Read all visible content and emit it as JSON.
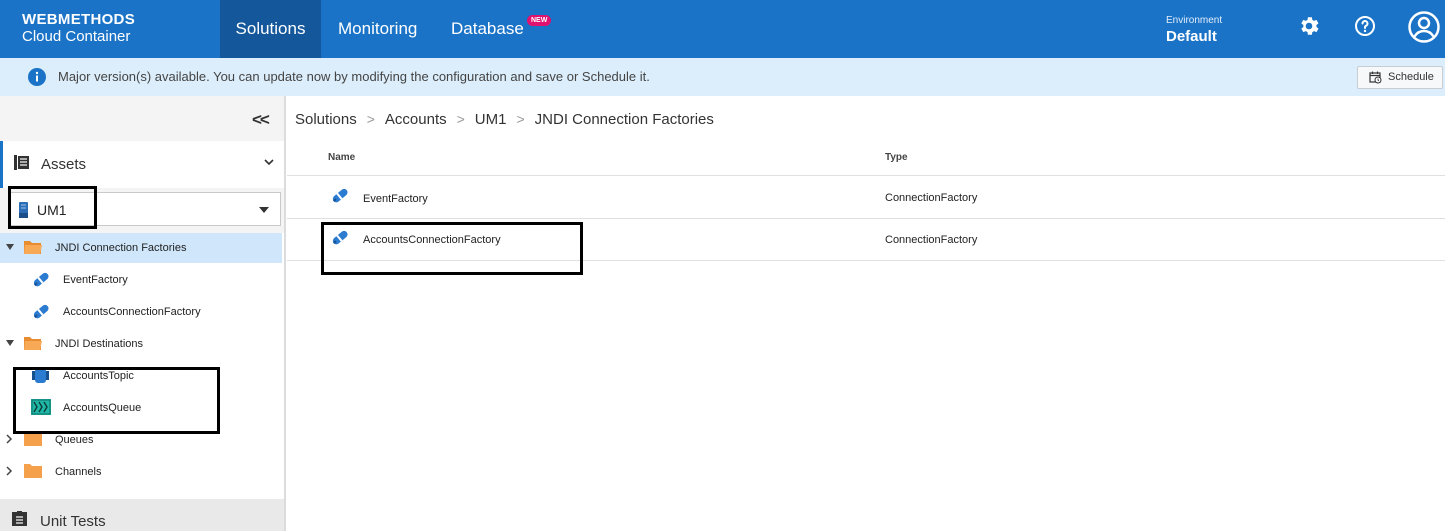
{
  "header": {
    "brand_line1": "WEBMETHODS",
    "brand_line2": "Cloud Container",
    "tabs": [
      {
        "label": "Solutions",
        "active": true
      },
      {
        "label": "Monitoring",
        "active": false
      },
      {
        "label": "Database",
        "active": false
      }
    ],
    "new_badge": "NEW",
    "environment_label": "Environment",
    "environment_value": "Default",
    "icons": [
      "gear-icon",
      "help-icon",
      "user-icon"
    ]
  },
  "info_bar": {
    "icon": "info-icon",
    "message": "Major version(s) available. You can update now by modifying the configuration and save or Schedule it.",
    "schedule_label": "Schedule"
  },
  "sidebar": {
    "collapse_label": "<<",
    "assets_label": "Assets",
    "selected_asset": "UM1",
    "tree": [
      {
        "label": "JNDI Connection Factories",
        "type": "folder",
        "expanded": true,
        "selected": true
      },
      {
        "label": "EventFactory",
        "type": "connection-factory"
      },
      {
        "label": "AccountsConnectionFactory",
        "type": "connection-factory"
      },
      {
        "label": "JNDI Destinations",
        "type": "folder",
        "expanded": true
      },
      {
        "label": "AccountsTopic",
        "type": "topic"
      },
      {
        "label": "AccountsQueue",
        "type": "queue"
      },
      {
        "label": "Queues",
        "type": "folder",
        "expanded": false
      },
      {
        "label": "Channels",
        "type": "folder",
        "expanded": false
      }
    ],
    "unit_tests_label": "Unit Tests"
  },
  "main": {
    "breadcrumb": [
      "Solutions",
      "Accounts",
      "UM1",
      "JNDI Connection Factories"
    ],
    "breadcrumb_separator": ">",
    "columns": [
      "Name",
      "Type"
    ],
    "rows": [
      {
        "name": "EventFactory",
        "type": "ConnectionFactory"
      },
      {
        "name": "AccountsConnectionFactory",
        "type": "ConnectionFactory"
      }
    ]
  },
  "colors": {
    "header_bg": "#1a73c6",
    "active_tab_bg": "#14589b",
    "info_bar_bg": "#dceefb",
    "new_badge": "#e0126f",
    "folder": "#f5a04a",
    "selected_row": "#cfe6fb"
  }
}
